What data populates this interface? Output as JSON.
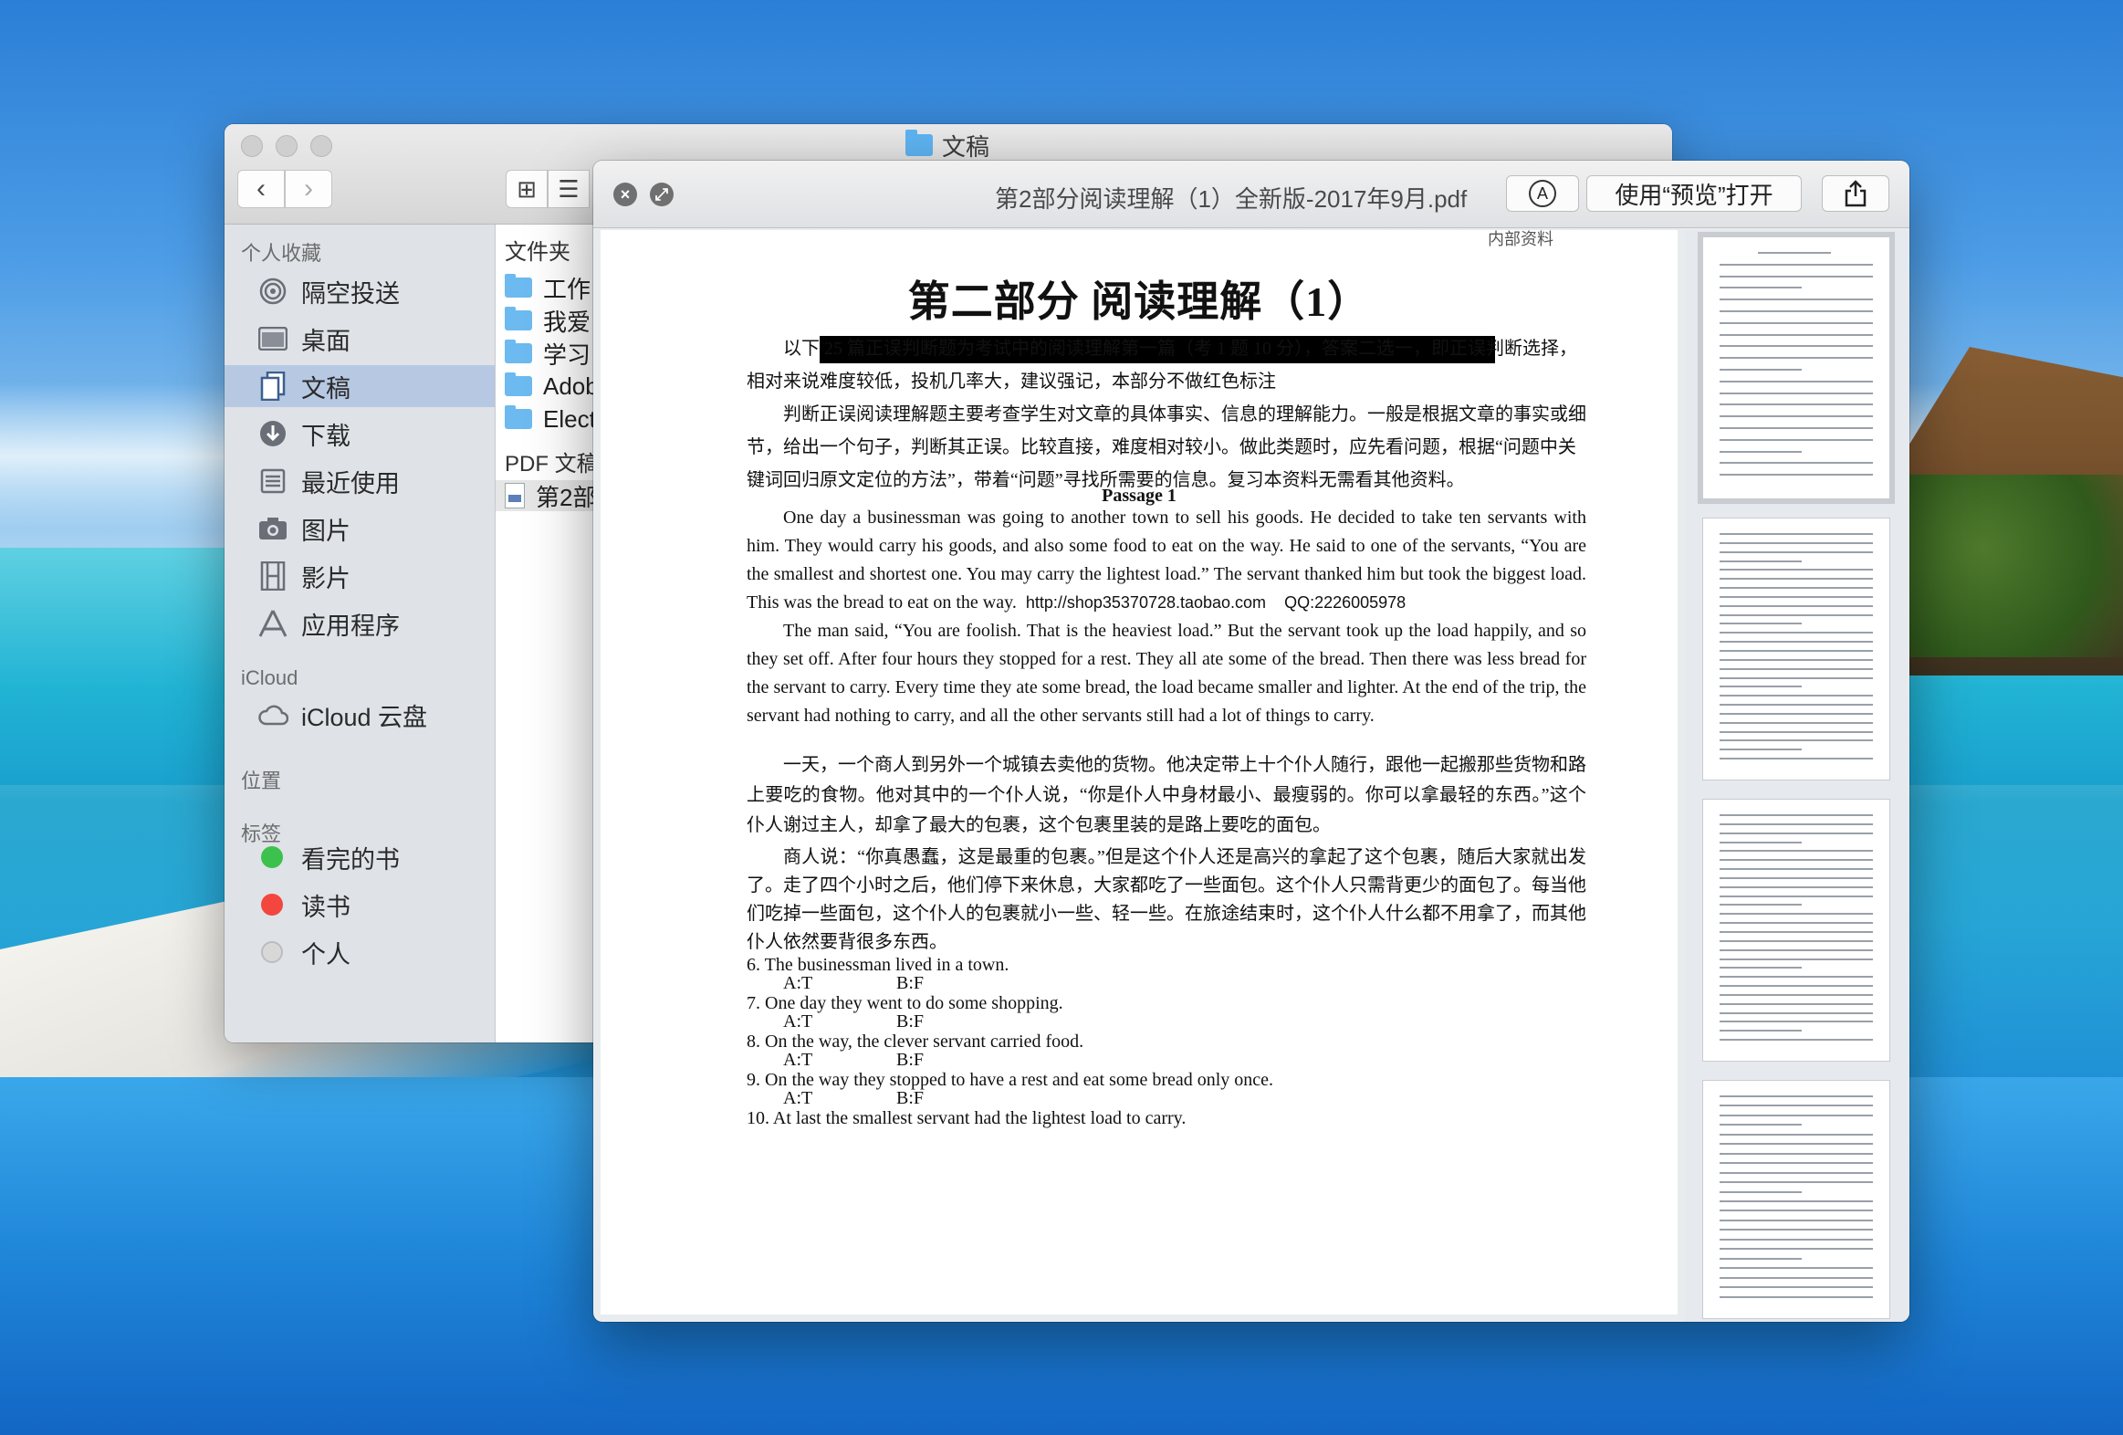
{
  "finder": {
    "title": "文稿",
    "nav": {
      "back": "‹",
      "forward": "›",
      "icon_view": "⊞",
      "list_view": "☰"
    },
    "sidebar": {
      "favorites_header": "个人收藏",
      "favorites": [
        {
          "label": "隔空投送",
          "icon": "airdrop-icon"
        },
        {
          "label": "桌面",
          "icon": "desktop-icon"
        },
        {
          "label": "文稿",
          "icon": "documents-icon",
          "selected": true
        },
        {
          "label": "下载",
          "icon": "download-icon"
        },
        {
          "label": "最近使用",
          "icon": "recents-icon"
        },
        {
          "label": "图片",
          "icon": "camera-icon"
        },
        {
          "label": "影片",
          "icon": "film-icon"
        },
        {
          "label": "应用程序",
          "icon": "apps-icon"
        }
      ],
      "icloud_header": "iCloud",
      "icloud_drive": "iCloud 云盘",
      "locations_header": "位置",
      "tags_header": "标签",
      "tags": [
        {
          "label": "看完的书",
          "color": "#3cc14d"
        },
        {
          "label": "读书",
          "color": "#f2463f"
        },
        {
          "label": "个人",
          "color": "#d8d8d8"
        }
      ]
    },
    "files": {
      "folders_header": "文件夹",
      "folders": [
        "工作",
        "我爱",
        "学习",
        "Adob",
        "Elect"
      ],
      "pdf_header": "PDF 文稿",
      "pdf_item": "第2部"
    }
  },
  "quicklook": {
    "filename": "第2部分阅读理解（1）全新版-2017年9月.pdf",
    "open_with_preview": "使用“预览”打开",
    "markup_icon": "markup-icon",
    "share_icon": "share-icon",
    "document": {
      "top_note": "内部资料",
      "title": "第二部分  阅读理解（1）",
      "intro1": "以下 25 篇正误判断题为考试中的阅读理解第一篇（考 1 题 10 分），答案二选一，即正误判断选择，相对来说难度较低，投机几率大，建议强记，本部分不做红色标注",
      "intro2": "判断正误阅读理解题主要考查学生对文章的具体事实、信息的理解能力。一般是根据文章的事实或细节，给出一个句子，判断其正误。比较直接，难度相对较小。做此类题时，应先看问题，根据“问题中关键词回归原文定位的方法”，带着“问题”寻找所需要的信息。复习本资料无需看其他资料。",
      "passage_title": "Passage 1",
      "en_p1": "One day a businessman was going to another town to sell his goods. He decided to take ten servants with him. They would carry his goods, and also some food to eat on the way. He said to one of the servants, “You are the smallest and shortest one. You may carry the lightest load.” The servant thanked him but took the biggest load. This was the bread to eat on the way.",
      "shop_url": "http://shop35370728.taobao.com",
      "shop_qq": "QQ:2226005978",
      "en_p2": "The man said, “You are foolish. That is the heaviest load.” But the servant took up the load happily, and so they set off. After four hours they stopped for a rest. They all ate some of the bread. Then there was less bread for the servant to carry. Every time they ate some bread, the load became smaller and lighter. At the end of the trip, the servant had nothing to carry, and all the other servants still had a lot of things to carry.",
      "cn_p1": "一天，一个商人到另外一个城镇去卖他的货物。他决定带上十个仆人随行，跟他一起搬那些货物和路上要吃的食物。他对其中的一个仆人说，“你是仆人中身材最小、最瘦弱的。你可以拿最轻的东西。”这个仆人谢过主人，却拿了最大的包裹，这个包裹里装的是路上要吃的面包。",
      "cn_p2": "商人说：“你真愚蠢，这是最重的包裹。”但是这个仆人还是高兴的拿起了这个包裹，随后大家就出发了。走了四个小时之后，他们停下来休息，大家都吃了一些面包。这个仆人只需背更少的面包了。每当他们吃掉一些面包，这个仆人的包裹就小一些、轻一些。在旅途结束时，这个仆人什么都不用拿了，而其他仆人依然要背很多东西。",
      "questions": [
        {
          "text": "6. The businessman lived in a town.",
          "a": "A:T",
          "b": "B:F"
        },
        {
          "text": "7. One day they went to do some shopping.",
          "a": "A:T",
          "b": "B:F"
        },
        {
          "text": "8. On the way, the clever servant carried food.",
          "a": "A:T",
          "b": "B:F"
        },
        {
          "text": "9. On the way they stopped to have a rest and eat some bread only once.",
          "a": "A:T",
          "b": "B:F"
        }
      ],
      "cut_line": "10. At last the smallest servant had the lightest load to carry."
    },
    "thumbnail_count": 4
  }
}
